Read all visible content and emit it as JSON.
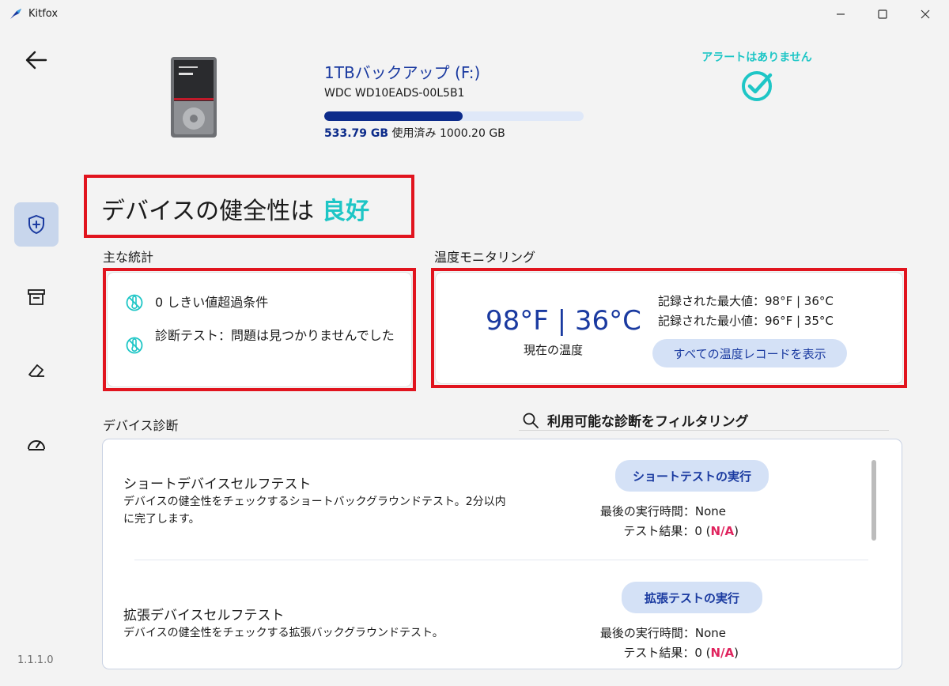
{
  "window": {
    "title": "Kitfox"
  },
  "app": {
    "version": "1.1.1.0"
  },
  "drive": {
    "name": "1TBバックアップ (F:)",
    "model": "WDC WD10EADS-00L5B1",
    "used": "533.79 GB",
    "used_label": "使用済み",
    "total": "1000.20 GB",
    "used_fraction": 0.5337
  },
  "alert": {
    "text": "アラートはありません"
  },
  "health": {
    "prefix": "デバイスの健全性は",
    "status": "良好"
  },
  "stats": {
    "label": "主な統計",
    "items": [
      {
        "text": "0 しきい値超過条件"
      },
      {
        "text": "診断テスト：問題は見つかりませんでした"
      }
    ]
  },
  "temperature": {
    "label": "温度モニタリング",
    "current": "98°F | 36°C",
    "current_label": "現在の温度",
    "max": "記録された最大値：98°F | 36°C",
    "min": "記録された最小値：96°F | 35°C",
    "button": "すべての温度レコードを表示"
  },
  "diagnostics": {
    "label": "デバイス診断",
    "filter": "利用可能な診断をフィルタリング",
    "tests": [
      {
        "title": "ショートデバイスセルフテスト",
        "desc": "デバイスの健全性をチェックするショートバックグラウンドテスト。2分以内に完了します。",
        "button": "ショートテストの実行",
        "last_run": "最後の実行時間：None",
        "result_prefix": "テスト結果：0 (",
        "result_status": "N/A",
        "result_suffix": ")"
      },
      {
        "title": "拡張デバイスセルフテスト",
        "desc": "デバイスの健全性をチェックする拡張バックグラウンドテスト。",
        "button": "拡張テストの実行",
        "last_run": "最後の実行時間：None",
        "result_prefix": "テスト結果：0 (",
        "result_status": "N/A",
        "result_suffix": ")"
      }
    ]
  },
  "colors": {
    "accent": "#1a3aa0",
    "good": "#1ec6c6",
    "highlight": "#e1141e",
    "na": "#e0245e"
  }
}
